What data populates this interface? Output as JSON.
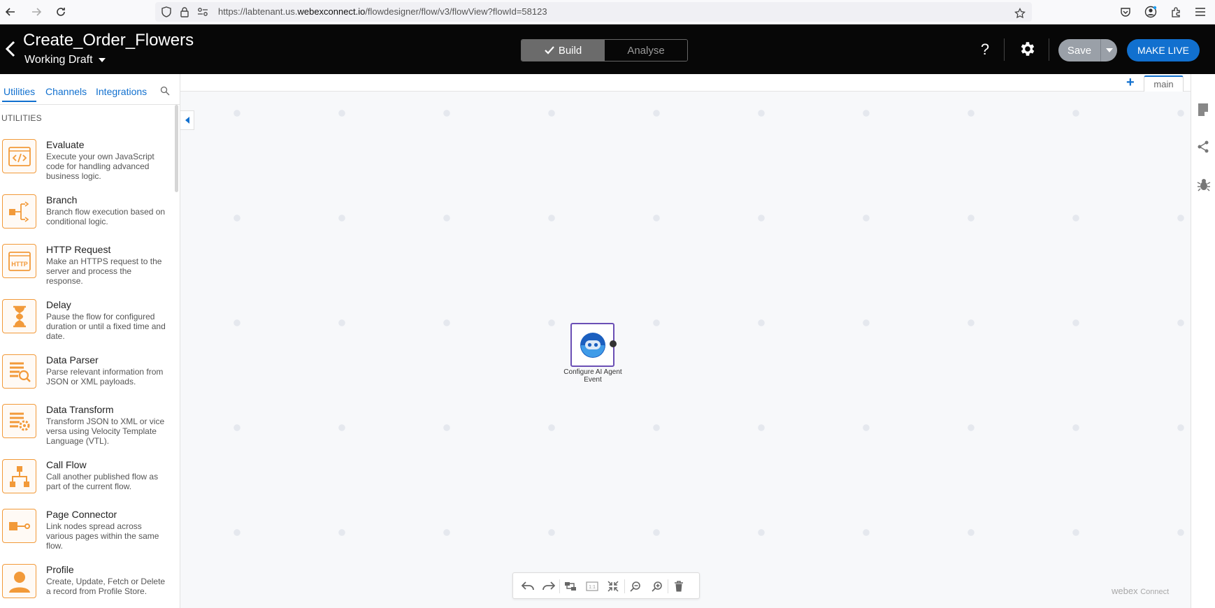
{
  "browser": {
    "url_prefix": "https://labtenant.us.",
    "url_domain": "webexconnect.io",
    "url_path": "/flowdesigner/flow/v3/flowView?flowId=58123"
  },
  "header": {
    "title": "Create_Order_Flowers",
    "draft_label": "Working Draft",
    "build_label": "Build",
    "analyse_label": "Analyse",
    "help_label": "?",
    "save_label": "Save",
    "make_live_label": "MAKE LIVE"
  },
  "sidebar": {
    "tabs": [
      "Utilities",
      "Channels",
      "Integrations"
    ],
    "section_title": "UTILITIES",
    "items": [
      {
        "name": "Evaluate",
        "desc": "Execute your own JavaScript code for handling advanced business logic.",
        "icon": "code-icon"
      },
      {
        "name": "Branch",
        "desc": "Branch flow execution based on conditional logic.",
        "icon": "branch-icon"
      },
      {
        "name": "HTTP Request",
        "desc": "Make an HTTPS request to the server and process the response.",
        "icon": "http-icon"
      },
      {
        "name": "Delay",
        "desc": "Pause the flow for configured duration or until a fixed time and date.",
        "icon": "hourglass-icon"
      },
      {
        "name": "Data Parser",
        "desc": "Parse relevant information from JSON or XML payloads.",
        "icon": "data-parser-icon"
      },
      {
        "name": "Data Transform",
        "desc": "Transform JSON to XML or vice versa using Velocity Template Language (VTL).",
        "icon": "data-transform-icon"
      },
      {
        "name": "Call Flow",
        "desc": "Call another published flow as part of the current flow.",
        "icon": "call-flow-icon"
      },
      {
        "name": "Page Connector",
        "desc": "Link nodes spread across various pages within the same flow.",
        "icon": "page-connector-icon"
      },
      {
        "name": "Profile",
        "desc": "Create, Update, Fetch or Delete a record from Profile Store.",
        "icon": "profile-icon"
      }
    ]
  },
  "canvas": {
    "page_tab": "main",
    "node_label": "Configure AI Agent Event",
    "brand": "webex",
    "brand_suffix": "Connect",
    "accent_color": "#1170cf",
    "node_border_color": "#6b4fb5",
    "utility_color": "#f29a3a"
  }
}
